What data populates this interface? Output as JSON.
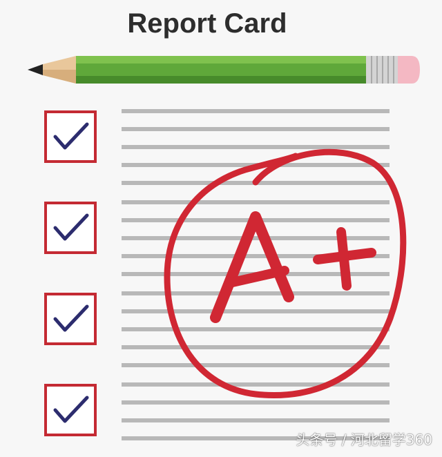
{
  "header": {
    "title": "Report Card"
  },
  "checklist": {
    "items": [
      {
        "checked": true,
        "icon": "checkmark-icon"
      },
      {
        "checked": true,
        "icon": "checkmark-icon"
      },
      {
        "checked": true,
        "icon": "checkmark-icon"
      },
      {
        "checked": true,
        "icon": "checkmark-icon"
      }
    ]
  },
  "grade": {
    "letter": "A",
    "modifier": "+",
    "icon": "circled-grade"
  },
  "watermark": {
    "text": "头条号 / 河北留学360"
  },
  "colors": {
    "ink_red": "#d02733",
    "check_blue": "#2c2c6e",
    "pencil_green": "#5fa83a",
    "line_gray": "#b8b8b8",
    "title": "#2d2d2d"
  }
}
